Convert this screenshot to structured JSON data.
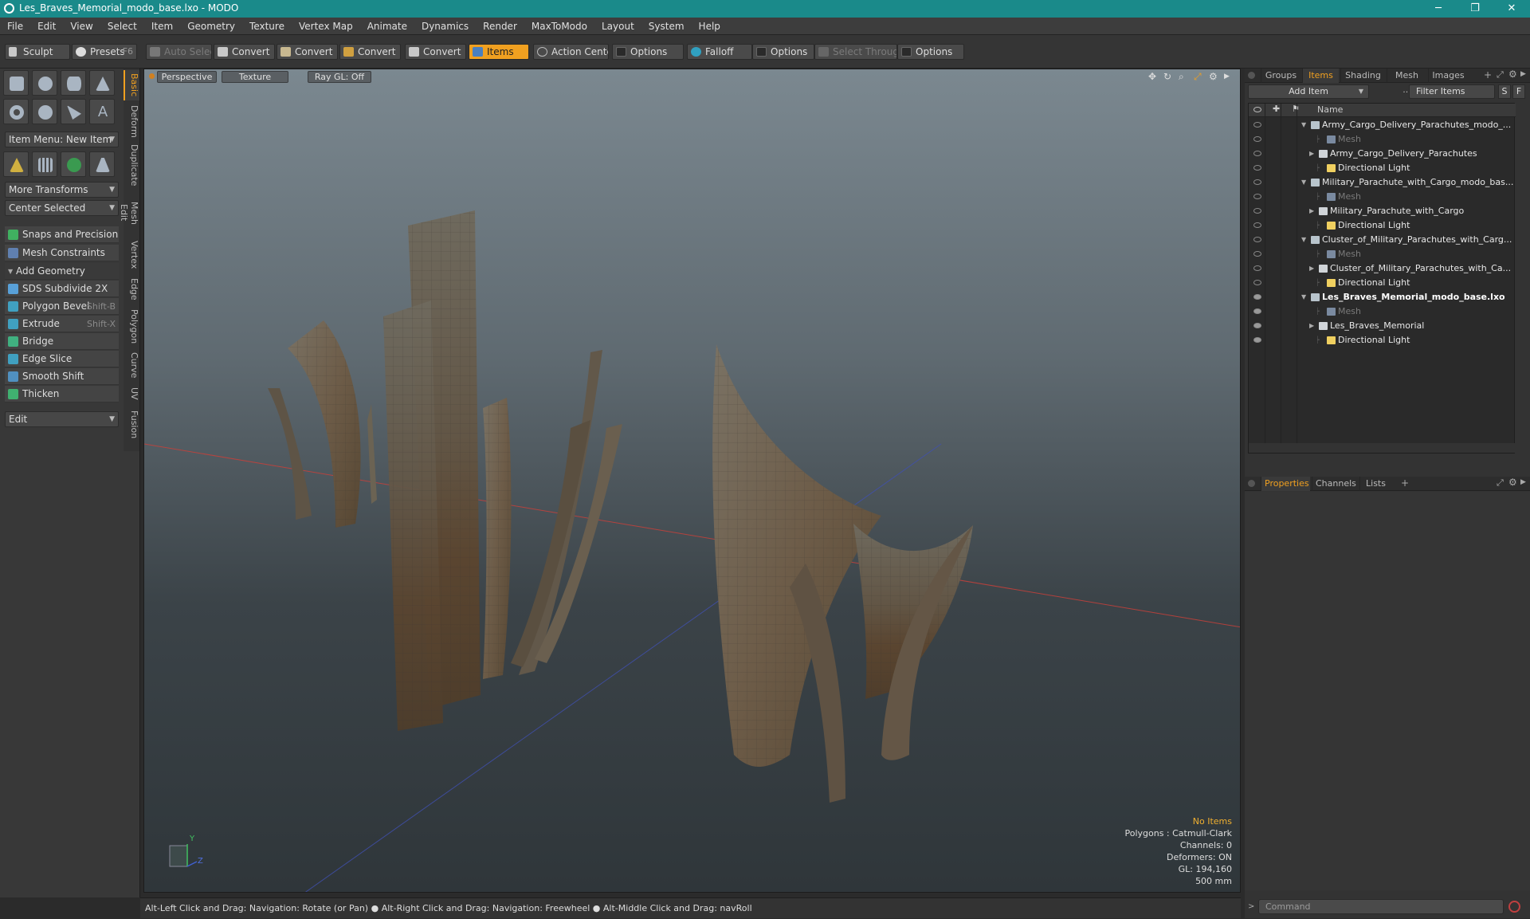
{
  "window": {
    "title": "Les_Braves_Memorial_modo_base.lxo - MODO",
    "minimize": "─",
    "maximize": "❐",
    "close": "✕"
  },
  "menu": [
    "File",
    "Edit",
    "View",
    "Select",
    "Item",
    "Geometry",
    "Texture",
    "Vertex Map",
    "Animate",
    "Dynamics",
    "Render",
    "MaxToModo",
    "Layout",
    "System",
    "Help"
  ],
  "toolbar": {
    "sculpt": "Sculpt",
    "presets": "Presets",
    "presets_key": "F6",
    "auto_select": "Auto Select",
    "convert1": "Convert",
    "convert2": "Convert",
    "convert3": "Convert",
    "convert4": "Convert",
    "items": "Items",
    "action_center": "Action Center",
    "options1": "Options",
    "falloff": "Falloff",
    "options2": "Options",
    "select_through": "Select Through",
    "options3": "Options"
  },
  "left": {
    "item_menu": "Item Menu: New Item",
    "more_transforms": "More Transforms",
    "center_selected": "Center Selected",
    "snaps": "Snaps and Precision",
    "mesh_constraints": "Mesh Constraints",
    "add_geometry": "Add Geometry",
    "tools": [
      {
        "label": "SDS Subdivide 2X",
        "key": ""
      },
      {
        "label": "Polygon Bevel",
        "key": "Shift-B"
      },
      {
        "label": "Extrude",
        "key": "Shift-X"
      },
      {
        "label": "Bridge",
        "key": ""
      },
      {
        "label": "Edge Slice",
        "key": ""
      },
      {
        "label": "Smooth Shift",
        "key": ""
      },
      {
        "label": "Thicken",
        "key": ""
      }
    ],
    "edit": "Edit",
    "side_tabs": [
      "Basic",
      "Deform",
      "Duplicate",
      "Mesh Edit",
      "Vertex",
      "Edge",
      "Polygon",
      "Curve",
      "UV",
      "Fusion"
    ]
  },
  "viewport": {
    "perspective": "Perspective",
    "texture": "Texture",
    "raygl": "Ray GL: Off",
    "stats": {
      "no_items": "No Items",
      "polygons": "Polygons : Catmull-Clark",
      "channels": "Channels: 0",
      "deformers": "Deformers: ON",
      "gl": "GL: 194,160",
      "scale": "500 mm"
    },
    "gizmo_y": "Y",
    "gizmo_z": "Z"
  },
  "statusbar": {
    "hint1": "Alt-Left Click and Drag: Navigation: Rotate (or Pan)",
    "hint2": "Alt-Right Click and Drag: Navigation: Freewheel",
    "hint3": "Alt-Middle Click and Drag: navRoll"
  },
  "right": {
    "tabs": [
      "Groups",
      "Items",
      "Shading",
      "Mesh ...",
      "Images"
    ],
    "add_item": "Add Item",
    "filter_items": "Filter Items",
    "filter_s": "S",
    "filter_f": "F",
    "name_col": "Name",
    "tree": [
      {
        "label": "Army_Cargo_Delivery_Parachutes_modo_...",
        "kind": "scene",
        "indent": 0,
        "arrow": "▼",
        "dim": false,
        "bold": false,
        "eye": false
      },
      {
        "label": "Mesh",
        "kind": "mesh",
        "indent": 2,
        "arrow": "",
        "dim": true,
        "bold": false,
        "eye": false
      },
      {
        "label": "Army_Cargo_Delivery_Parachutes",
        "kind": "group",
        "indent": 1,
        "arrow": "▶",
        "dim": false,
        "bold": false,
        "eye": false
      },
      {
        "label": "Directional Light",
        "kind": "light",
        "indent": 2,
        "arrow": "",
        "dim": false,
        "bold": false,
        "eye": false
      },
      {
        "label": "Military_Parachute_with_Cargo_modo_bas...",
        "kind": "scene",
        "indent": 0,
        "arrow": "▼",
        "dim": false,
        "bold": false,
        "eye": false
      },
      {
        "label": "Mesh",
        "kind": "mesh",
        "indent": 2,
        "arrow": "",
        "dim": true,
        "bold": false,
        "eye": false
      },
      {
        "label": "Military_Parachute_with_Cargo",
        "kind": "group",
        "indent": 1,
        "arrow": "▶",
        "dim": false,
        "bold": false,
        "eye": false
      },
      {
        "label": "Directional Light",
        "kind": "light",
        "indent": 2,
        "arrow": "",
        "dim": false,
        "bold": false,
        "eye": false
      },
      {
        "label": "Cluster_of_Military_Parachutes_with_Carg...",
        "kind": "scene",
        "indent": 0,
        "arrow": "▼",
        "dim": false,
        "bold": false,
        "eye": false
      },
      {
        "label": "Mesh",
        "kind": "mesh",
        "indent": 2,
        "arrow": "",
        "dim": true,
        "bold": false,
        "eye": false
      },
      {
        "label": "Cluster_of_Military_Parachutes_with_Ca...",
        "kind": "group",
        "indent": 1,
        "arrow": "▶",
        "dim": false,
        "bold": false,
        "eye": false
      },
      {
        "label": "Directional Light",
        "kind": "light",
        "indent": 2,
        "arrow": "",
        "dim": false,
        "bold": false,
        "eye": false
      },
      {
        "label": "Les_Braves_Memorial_modo_base.lxo",
        "kind": "scene",
        "indent": 0,
        "arrow": "▼",
        "dim": false,
        "bold": true,
        "eye": true
      },
      {
        "label": "Mesh",
        "kind": "mesh",
        "indent": 2,
        "arrow": "",
        "dim": true,
        "bold": false,
        "eye": true
      },
      {
        "label": "Les_Braves_Memorial",
        "kind": "group",
        "indent": 1,
        "arrow": "▶",
        "dim": false,
        "bold": false,
        "eye": true
      },
      {
        "label": "Directional Light",
        "kind": "light",
        "indent": 2,
        "arrow": "",
        "dim": false,
        "bold": false,
        "eye": true
      }
    ],
    "bottom_tabs": [
      "Properties",
      "Channels",
      "Lists"
    ],
    "command": "Command"
  },
  "colors": {
    "accent": "#f0a020",
    "title_bar": "#1a8a8a",
    "x_axis": "#c8403a",
    "z_axis": "#4050b0"
  }
}
